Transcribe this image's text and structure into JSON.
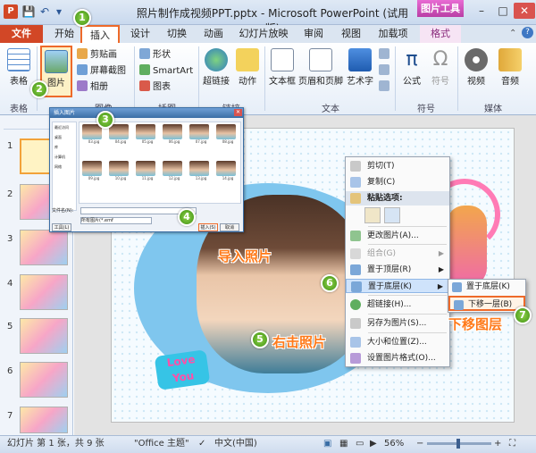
{
  "window": {
    "title": "照片制作成视频PPT.pptx - Microsoft PowerPoint (试用版)",
    "picture_tools_label": "图片工具",
    "min": "–",
    "max": "□",
    "close": "✕"
  },
  "quick_access": {
    "save": "💾",
    "undo": "↶",
    "redo": "▾"
  },
  "tabs": [
    {
      "label": "文件"
    },
    {
      "label": "开始"
    },
    {
      "label": "插入"
    },
    {
      "label": "设计"
    },
    {
      "label": "切换"
    },
    {
      "label": "动画"
    },
    {
      "label": "幻灯片放映"
    },
    {
      "label": "审阅"
    },
    {
      "label": "视图"
    },
    {
      "label": "加载项"
    },
    {
      "label": "格式"
    }
  ],
  "ribbon": {
    "table": {
      "label": "表格",
      "group": "表格"
    },
    "picture": {
      "label": "图片"
    },
    "images_group": "图像",
    "clip_art": "剪贴画",
    "screenshot": "屏幕截图",
    "album": "相册",
    "illustrations_group": "插图",
    "shapes": "形状",
    "smartart": "SmartArt",
    "chart": "图表",
    "hyperlink": "超链接",
    "action": "动作",
    "links_group": "链接",
    "textbox": "文本框",
    "header_footer": "页眉和页脚",
    "wordart": "艺术字",
    "text_group": "文本",
    "equation": "公式",
    "symbol": "符号",
    "symbols_group": "符号",
    "video": "视频",
    "audio": "音频",
    "media_group": "媒体"
  },
  "dialog": {
    "title": "插入图片",
    "sidebar": [
      "最近访问",
      "桌面",
      "库",
      "计算机",
      "网络"
    ],
    "files": [
      "03.jpg",
      "04.jpg",
      "05.jpg",
      "06.jpg",
      "07.jpg",
      "08.jpg",
      "09.jpg",
      "10.jpg",
      "11.jpg",
      "12.jpg",
      "13.jpg",
      "14.jpg"
    ],
    "filename_label": "文件名(N):",
    "filetype_label": "所有图片(*.emf",
    "insert": "插入(S)",
    "cancel": "取消",
    "tools": "工具(L)"
  },
  "context_menu": {
    "cut": "剪切(T)",
    "copy": "复制(C)",
    "paste_heading": "粘贴选项:",
    "change_picture": "更改图片(A)...",
    "group": "组合(G)",
    "bring_front": "置于顶层(R)",
    "send_back": "置于底层(K)",
    "hyperlink": "超链接(H)...",
    "save_as_picture": "另存为图片(S)...",
    "size_position": "大小和位置(Z)...",
    "format_picture": "设置图片格式(O)...",
    "arrow": "▶"
  },
  "submenu": {
    "send_to_back": "置于底层(K)",
    "send_backward": "下移一层(B)"
  },
  "slide": {
    "love_text": "Love You"
  },
  "annotations": {
    "steps": [
      "1",
      "2",
      "3",
      "4",
      "5",
      "6",
      "7"
    ],
    "insert_photo": "导入照片",
    "right_click_photo": "右击照片",
    "move_down_layer": "下移图层"
  },
  "thumbnails": [
    "1",
    "2",
    "3",
    "4",
    "5",
    "6",
    "7"
  ],
  "status": {
    "slide_info": "幻灯片 第 1 张，共 9 张",
    "theme": "\"Office 主题\"",
    "language": "中文(中国)",
    "zoom": "56%",
    "zoom_out": "−",
    "zoom_in": "+"
  }
}
